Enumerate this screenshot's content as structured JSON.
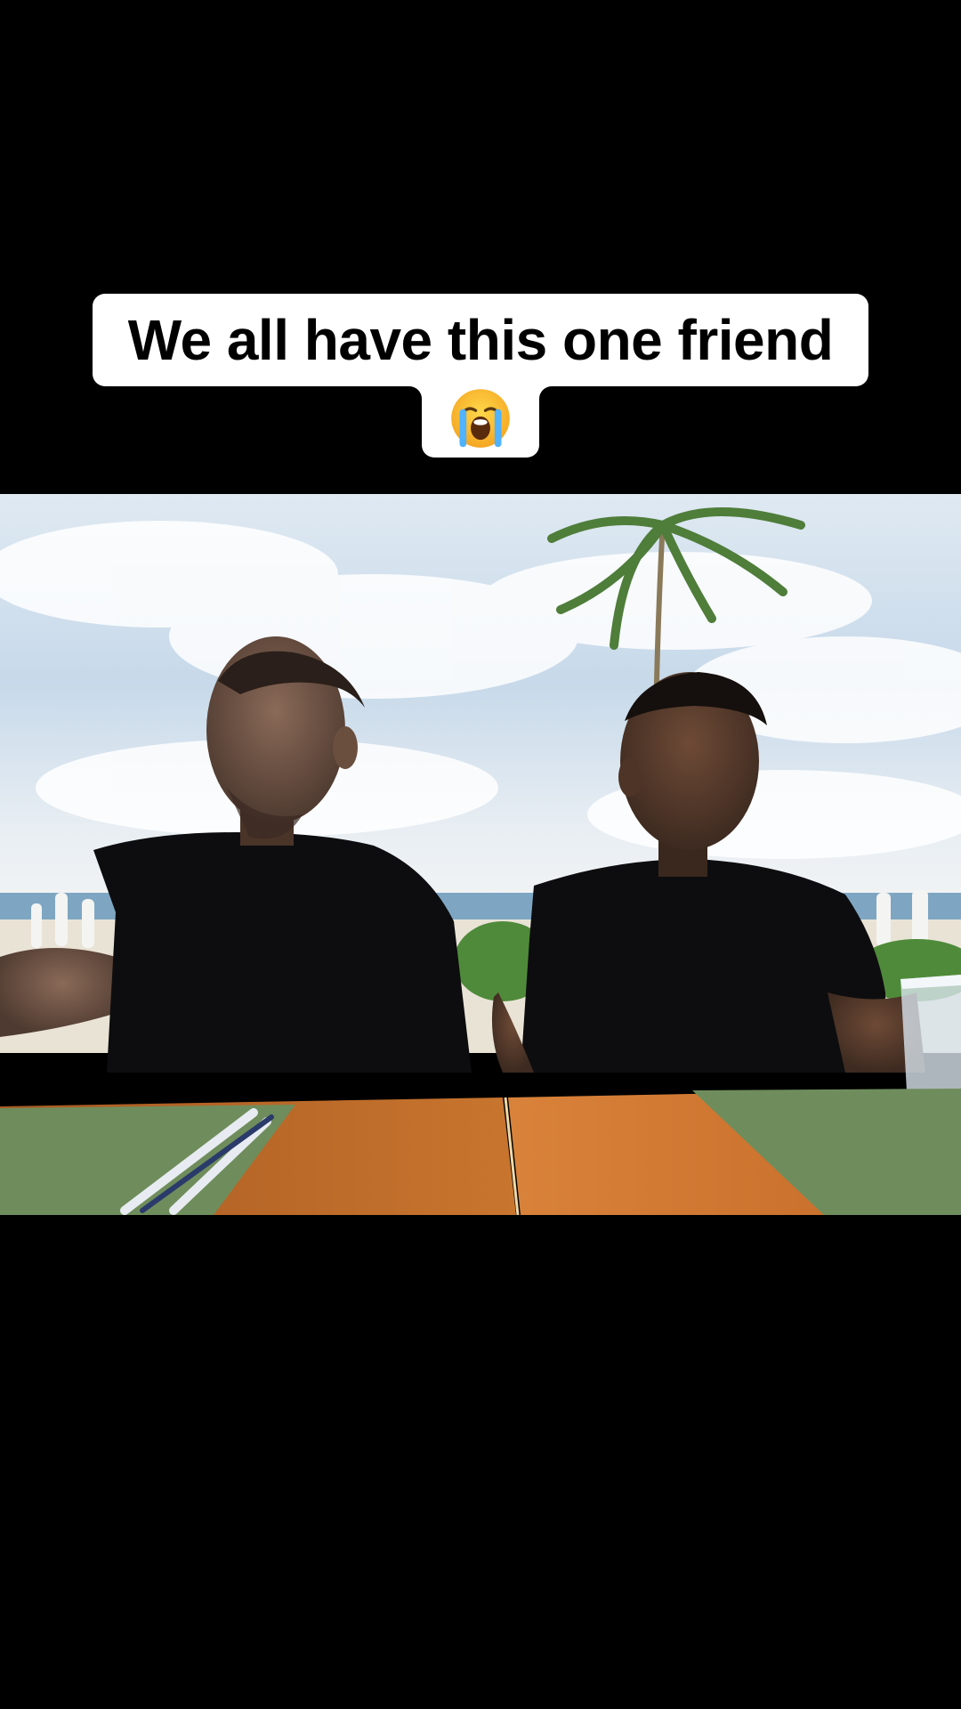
{
  "caption": {
    "line1": "We all have this one friend",
    "emoji_icon": "loudly-crying-face-icon"
  },
  "video": {
    "scene": "photo"
  },
  "colors": {
    "background": "#000000",
    "caption_bg": "#ffffff",
    "caption_text": "#000000"
  }
}
